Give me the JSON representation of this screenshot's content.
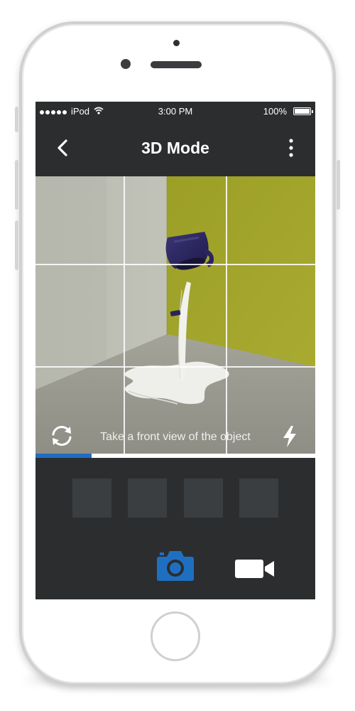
{
  "status_bar": {
    "carrier": "iPod",
    "time": "3:00 PM",
    "battery": "100%"
  },
  "nav": {
    "title": "3D Mode",
    "back_icon": "chevron-left-icon",
    "menu_icon": "more-vertical-icon"
  },
  "viewfinder": {
    "hint": "Take a front view of the object",
    "rotate_icon": "switch-camera-icon",
    "flash_icon": "flash-icon"
  },
  "capture": {
    "progress_fraction": 0.2,
    "thumbnails": [
      "",
      "",
      "",
      ""
    ],
    "photo_icon": "camera-icon",
    "video_icon": "video-icon"
  },
  "colors": {
    "accent": "#1f6fc1",
    "screen_bg": "#2b2d2e",
    "thumb_bg": "#3b3e40",
    "wall_green": "#a0a32a",
    "wall_gray": "#c2c3b9"
  }
}
